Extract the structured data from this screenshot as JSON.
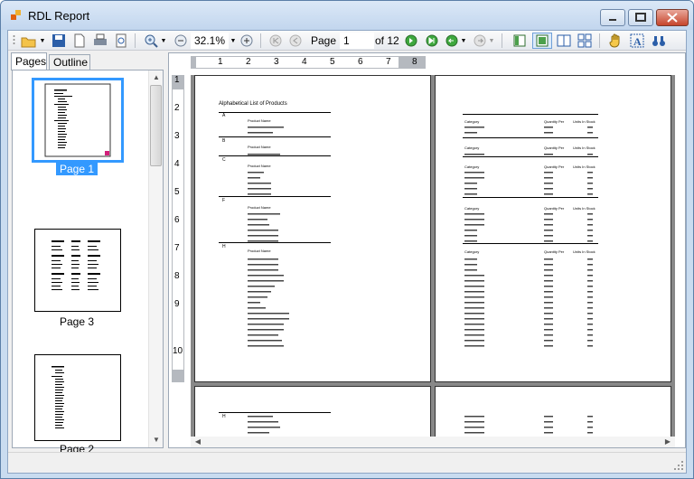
{
  "window": {
    "title": "RDL Report"
  },
  "toolbar": {
    "zoom_value": "32.1%",
    "page_label": "Page",
    "page_value": "1",
    "page_of": "of 12"
  },
  "tabs": [
    {
      "label": "Pages"
    },
    {
      "label": "Outline"
    }
  ],
  "thumbnails": [
    {
      "label": "Page 1"
    },
    {
      "label": "Page 3"
    },
    {
      "label": "Page 2"
    }
  ],
  "ruler": {
    "horizontal": [
      "1",
      "2",
      "3",
      "4",
      "5",
      "6",
      "7",
      "8"
    ],
    "vertical": [
      "1",
      "2",
      "3",
      "4",
      "5",
      "6",
      "7",
      "8",
      "9",
      "10"
    ]
  },
  "report": {
    "title": "Alphabetical List of Products",
    "letters": [
      "A",
      "B",
      "C",
      "F",
      "H",
      "H"
    ],
    "column_headers": [
      "Product Name",
      "Category",
      "Quantity Per",
      "Units In Stock"
    ]
  },
  "colors": {
    "accent": "#3399ff",
    "title_bar": "#c9dcf0",
    "page_bg": "#888888"
  }
}
